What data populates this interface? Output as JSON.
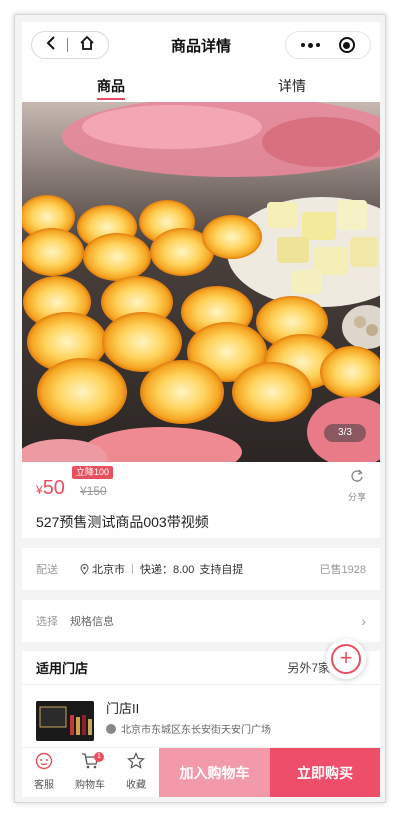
{
  "navbar": {
    "title": "商品详情",
    "back_icon": "chevron-left-icon",
    "home_icon": "home-icon",
    "more_icon": "more-dots-icon",
    "close_icon": "capsule-close-icon"
  },
  "tabs": [
    {
      "label": "商品",
      "active": true
    },
    {
      "label": "详情",
      "active": false
    }
  ],
  "gallery": {
    "pager": "3/3"
  },
  "product": {
    "presale_tag": "立降100",
    "currency": "¥",
    "price": "50",
    "original_price": "¥150",
    "share_label": "分享",
    "title": "527预售测试商品003带视频"
  },
  "delivery": {
    "label": "配送",
    "city": "北京市",
    "shipping": "快递：8.00",
    "pickup": "支持自提",
    "sold": "已售1928"
  },
  "spec": {
    "label": "选择",
    "value": "规格信息"
  },
  "stores": {
    "title": "适用门店",
    "more": "另外7家",
    "store_name": "门店II",
    "store_address": "北京市东城区东长安街天安门广场"
  },
  "bottom_bar": {
    "service_label": "客服",
    "cart_label": "购物车",
    "cart_count": "1",
    "favorite_label": "收藏",
    "add_to_cart": "加入购物车",
    "buy_now": "立即购买"
  },
  "colors": {
    "accent": "#e8505f",
    "add_to_cart_bg": "#f29aa9",
    "buy_now_bg": "#ef4e6b"
  }
}
